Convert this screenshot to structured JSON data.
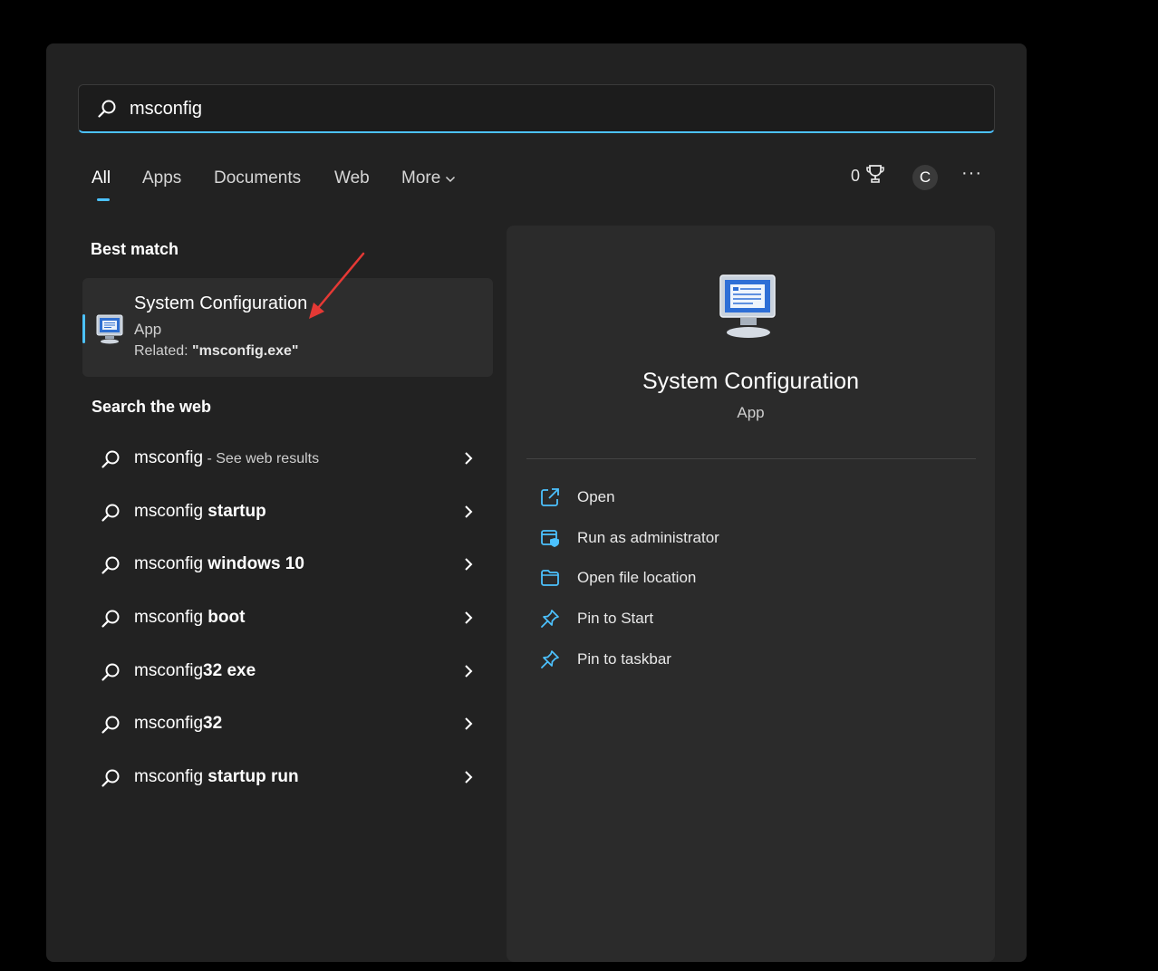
{
  "search": {
    "value": "msconfig",
    "accent_color": "#4cc2ff"
  },
  "tabs": [
    {
      "label": "All"
    },
    {
      "label": "Apps"
    },
    {
      "label": "Documents"
    },
    {
      "label": "Web"
    },
    {
      "label": "More"
    }
  ],
  "header_actions": {
    "points_value": "0",
    "points_icon": "trophy-icon",
    "avatar_initial": "C",
    "more_label": "···"
  },
  "best_match": {
    "section_title": "Best match",
    "title": "System Configuration",
    "type": "App",
    "related_prefix": "Related: ",
    "related_value": "\"msconfig.exe\""
  },
  "web": {
    "section_title": "Search the web",
    "items": [
      {
        "base": "msconfig",
        "bold": "",
        "suffix": " - See web results"
      },
      {
        "base": "msconfig",
        "bold": " startup",
        "suffix": ""
      },
      {
        "base": "msconfig",
        "bold": " windows 10",
        "suffix": ""
      },
      {
        "base": "msconfig",
        "bold": " boot",
        "suffix": ""
      },
      {
        "base": "msconfig",
        "bold": "32 exe",
        "suffix": ""
      },
      {
        "base": "msconfig",
        "bold": "32",
        "suffix": ""
      },
      {
        "base": "msconfig",
        "bold": " startup run",
        "suffix": ""
      }
    ]
  },
  "detail": {
    "title": "System Configuration",
    "type": "App",
    "actions": [
      {
        "label": "Open",
        "icon": "open-external-icon"
      },
      {
        "label": "Run as administrator",
        "icon": "run-as-admin-icon"
      },
      {
        "label": "Open file location",
        "icon": "folder-icon"
      },
      {
        "label": "Pin to Start",
        "icon": "pin-icon"
      },
      {
        "label": "Pin to taskbar",
        "icon": "pin-icon"
      }
    ]
  }
}
